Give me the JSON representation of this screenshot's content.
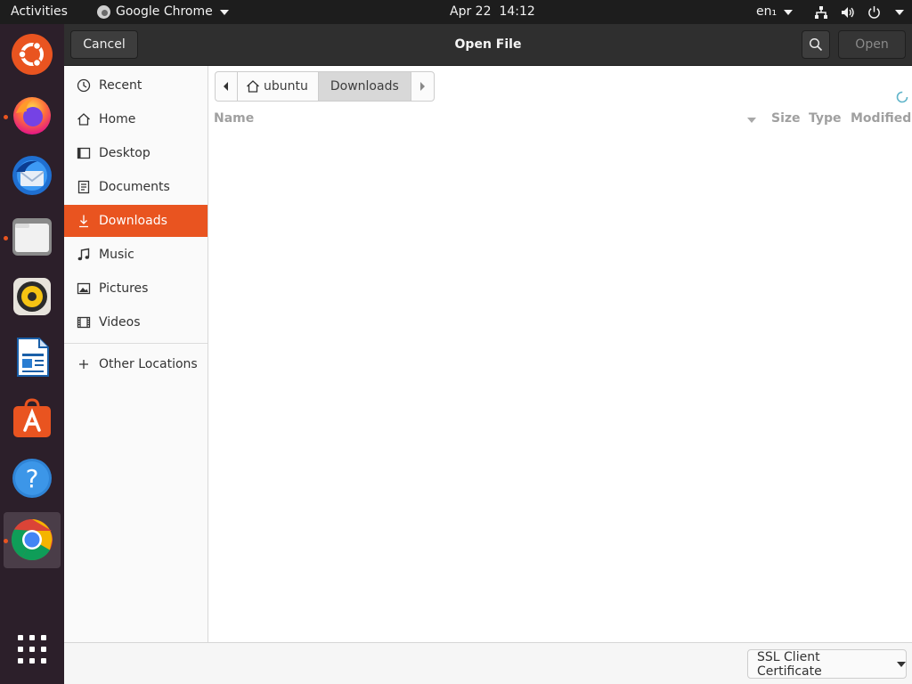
{
  "topbar": {
    "activities": "Activities",
    "app_name": "Google Chrome",
    "date": "Apr 22",
    "time": "14:12",
    "language": "en₁"
  },
  "dock": {
    "apps": [
      {
        "name": "ubuntu-logo-icon"
      },
      {
        "name": "firefox-icon",
        "running": true
      },
      {
        "name": "thunderbird-icon"
      },
      {
        "name": "files-icon",
        "running": true
      },
      {
        "name": "rhythmbox-icon"
      },
      {
        "name": "libreoffice-writer-icon"
      },
      {
        "name": "software-center-icon"
      },
      {
        "name": "help-icon"
      },
      {
        "name": "chrome-icon",
        "running": true,
        "active": true
      }
    ],
    "grid_button": "show-applications-icon"
  },
  "dialog": {
    "title": "Open File",
    "cancel": "Cancel",
    "open": "Open",
    "sidebar": {
      "items": [
        {
          "label": "Recent",
          "icon": "clock-icon"
        },
        {
          "label": "Home",
          "icon": "home-icon"
        },
        {
          "label": "Desktop",
          "icon": "desktop-icon"
        },
        {
          "label": "Documents",
          "icon": "document-icon"
        },
        {
          "label": "Downloads",
          "icon": "download-icon",
          "active": true
        },
        {
          "label": "Music",
          "icon": "music-icon"
        },
        {
          "label": "Pictures",
          "icon": "picture-icon"
        },
        {
          "label": "Videos",
          "icon": "video-icon"
        }
      ],
      "other": {
        "label": "Other Locations",
        "icon": "plus-icon"
      }
    },
    "pathbar": {
      "segments": [
        "ubuntu",
        "Downloads"
      ]
    },
    "columns": {
      "name": "Name",
      "size": "Size",
      "type": "Type",
      "modified": "Modified"
    },
    "filter": "SSL Client Certificate"
  },
  "colors": {
    "accent": "#e95420",
    "headerbar": "#2f2f2f",
    "topbar": "#1d1d1d",
    "dock": "#2c1f2a"
  }
}
